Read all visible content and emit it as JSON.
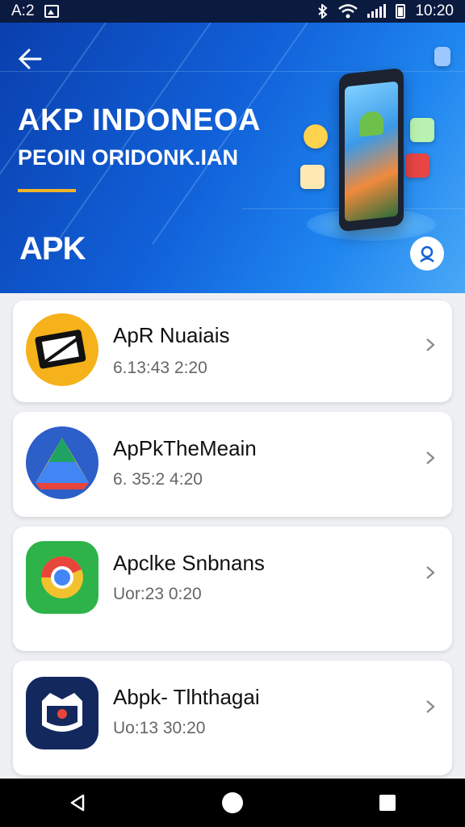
{
  "status_bar": {
    "left_text": "A:2",
    "time": "10:20",
    "icons": [
      "gallery-icon",
      "bluetooth-icon",
      "wifi-icon",
      "signal-icon",
      "battery-icon"
    ]
  },
  "header": {
    "back_icon": "arrow-left-icon",
    "title": "AKP INDONEOA",
    "subtitle": "PEOIN ORIDONK.IAN",
    "logo_text": "APK",
    "profile_icon": "user-icon",
    "accent_color": "#f0b429"
  },
  "apps": [
    {
      "name": "ApR Nuaiais",
      "meta": "6.13:43 2:20",
      "icon": "apk-badge-icon"
    },
    {
      "name": "ApPkTheMeain",
      "meta": "6. 35:2 4:20",
      "icon": "drive-triangle-icon"
    },
    {
      "name": "Apclke Snbnans",
      "meta": "Uor:23 0:20",
      "icon": "chrome-icon"
    },
    {
      "name": "Abpk- Tlhthagai",
      "meta": "Uo:13 30:20",
      "icon": "cat-face-icon"
    }
  ],
  "nav_bar": {
    "icons": [
      "back-triangle-icon",
      "home-circle-icon",
      "recents-square-icon"
    ]
  }
}
